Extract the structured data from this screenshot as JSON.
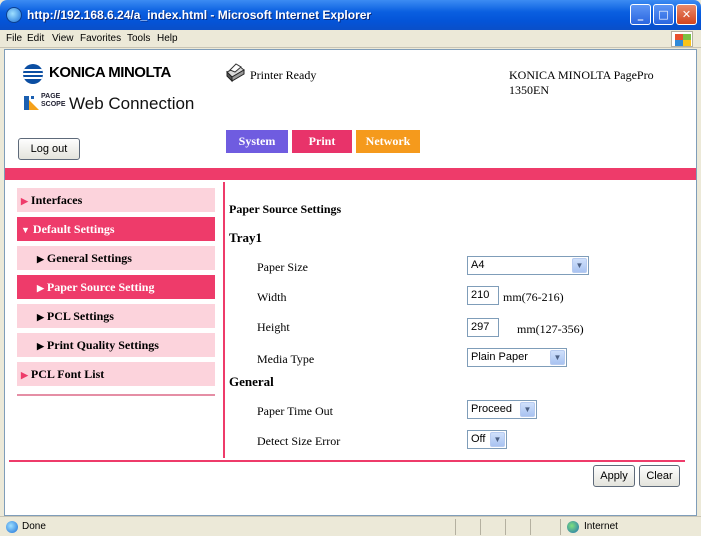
{
  "window": {
    "title": "http://192.168.6.24/a_index.html - Microsoft Internet Explorer",
    "minimize": "_",
    "maximize": "□",
    "close": "✕"
  },
  "menu": [
    "File",
    "Edit",
    "View",
    "Favorites",
    "Tools",
    "Help"
  ],
  "header": {
    "brand": "KONICA MINOLTA",
    "pagescope_small_1": "PAGE",
    "pagescope_small_2": "SCOPE",
    "product": "Web Connection",
    "printer_status": "Printer Ready",
    "model_line1": "KONICA MINOLTA PagePro",
    "model_line2": "1350EN",
    "logout_label": "Log out"
  },
  "tabs": [
    {
      "label": "System",
      "color": "#6F5CE0"
    },
    {
      "label": "Print",
      "color": "#E8336A"
    },
    {
      "label": "Network",
      "color": "#F59A1C"
    }
  ],
  "sidebar": {
    "items": [
      {
        "label": "Interfaces",
        "expanded": false,
        "active": false
      },
      {
        "label": "Default Settings",
        "expanded": true,
        "active": true
      },
      {
        "label": "General Settings",
        "active": false
      },
      {
        "label": "Paper Source Setting",
        "active": true
      },
      {
        "label": "PCL Settings",
        "active": false
      },
      {
        "label": "Print Quality Settings",
        "active": false
      },
      {
        "label": "PCL Font List",
        "active": false
      }
    ]
  },
  "form": {
    "title": "Paper Source Settings",
    "tray_heading": "Tray1",
    "paper_size_label": "Paper Size",
    "paper_size_value": "A4",
    "width_label": "Width",
    "width_value": "210",
    "width_unit": "mm(76-216)",
    "height_label": "Height",
    "height_value": "297",
    "height_unit": "mm(127-356)",
    "media_type_label": "Media Type",
    "media_type_value": "Plain Paper",
    "general_heading": "General",
    "paper_timeout_label": "Paper Time Out",
    "paper_timeout_value": "Proceed",
    "detect_size_label": "Detect Size Error",
    "detect_size_value": "Off",
    "apply_label": "Apply",
    "clear_label": "Clear"
  },
  "statusbar": {
    "done": "Done",
    "zone": "Internet"
  },
  "colors": {
    "accent_pink": "#EE3B6A",
    "sidebar_bg": "#FCD3DC",
    "tab_system": "#6F5CE0",
    "tab_print": "#E8336A",
    "tab_network": "#F59A1C"
  }
}
